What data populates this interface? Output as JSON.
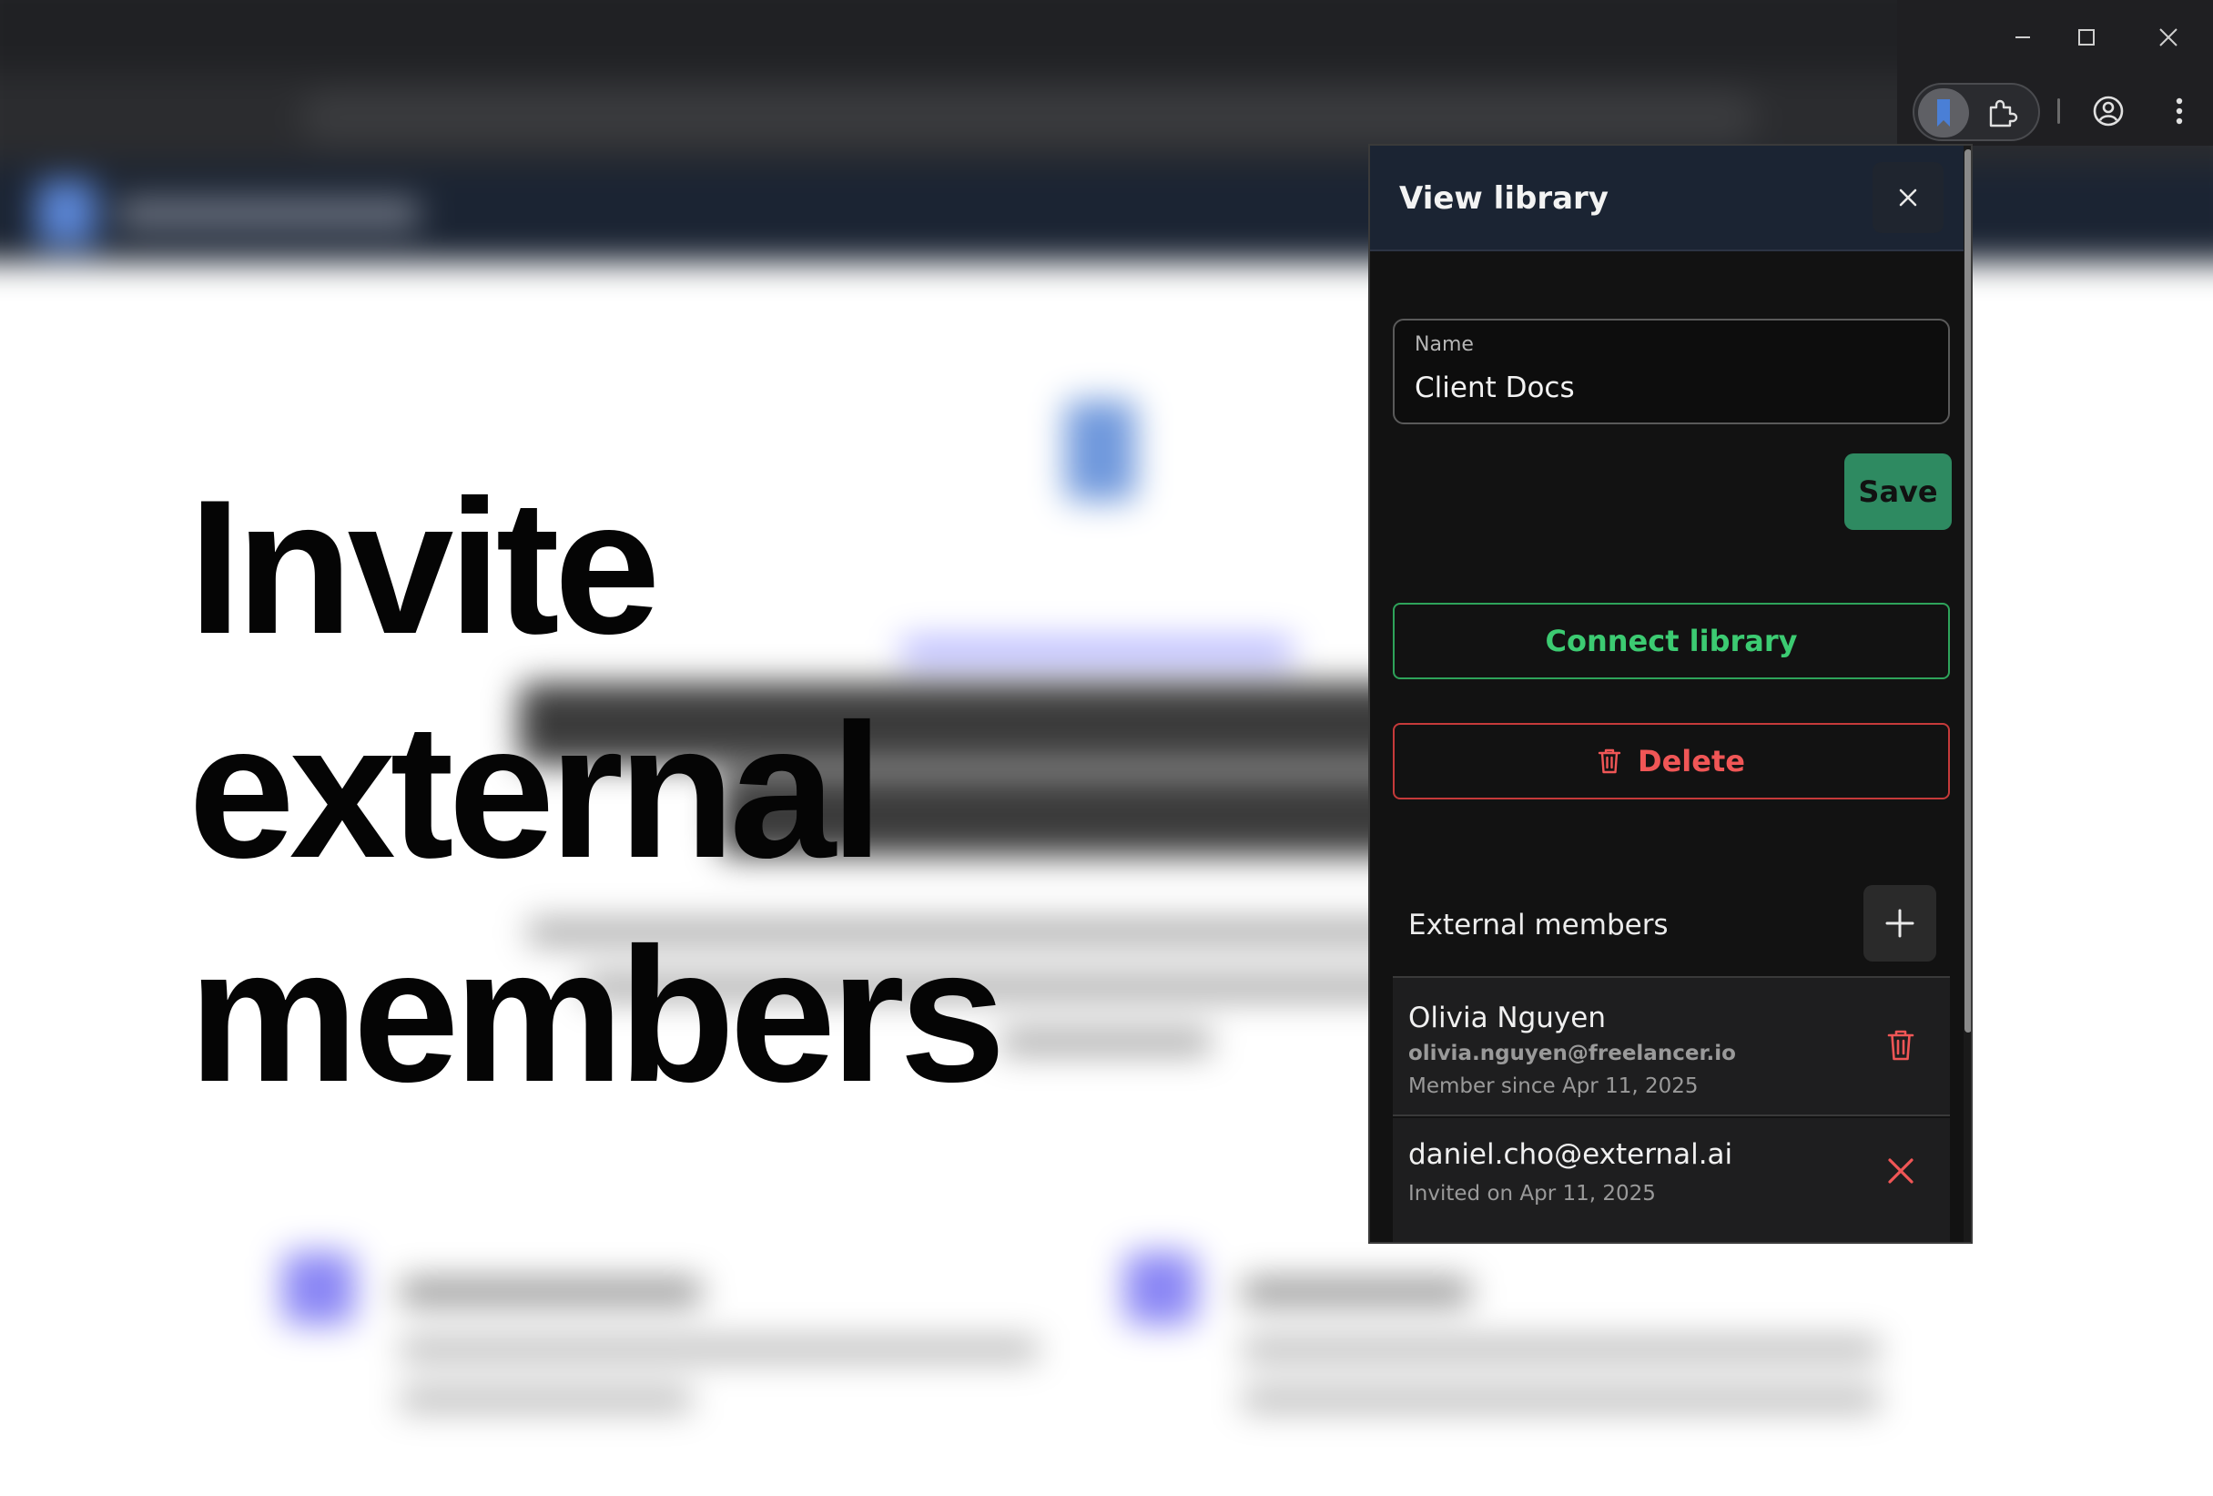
{
  "headline": {
    "lines": [
      "Invite",
      "external",
      "members"
    ]
  },
  "popup": {
    "title": "View library",
    "name_field": {
      "label": "Name",
      "value": "Client Docs"
    },
    "save_label": "Save",
    "connect_label": "Connect library",
    "delete_label": "Delete",
    "members_title": "External members",
    "members": [
      {
        "name": "Olivia Nguyen",
        "email": "olivia.nguyen@freelancer.io",
        "meta": "Member since Apr 11, 2025",
        "action": "trash-icon"
      },
      {
        "name": "daniel.cho@external.ai",
        "meta": "Invited on Apr 11, 2025",
        "action": "x-icon"
      }
    ]
  },
  "colors": {
    "save": "#2e8a61",
    "connect": "#3ccb72",
    "danger": "#f05656",
    "header": "#1b2433"
  }
}
